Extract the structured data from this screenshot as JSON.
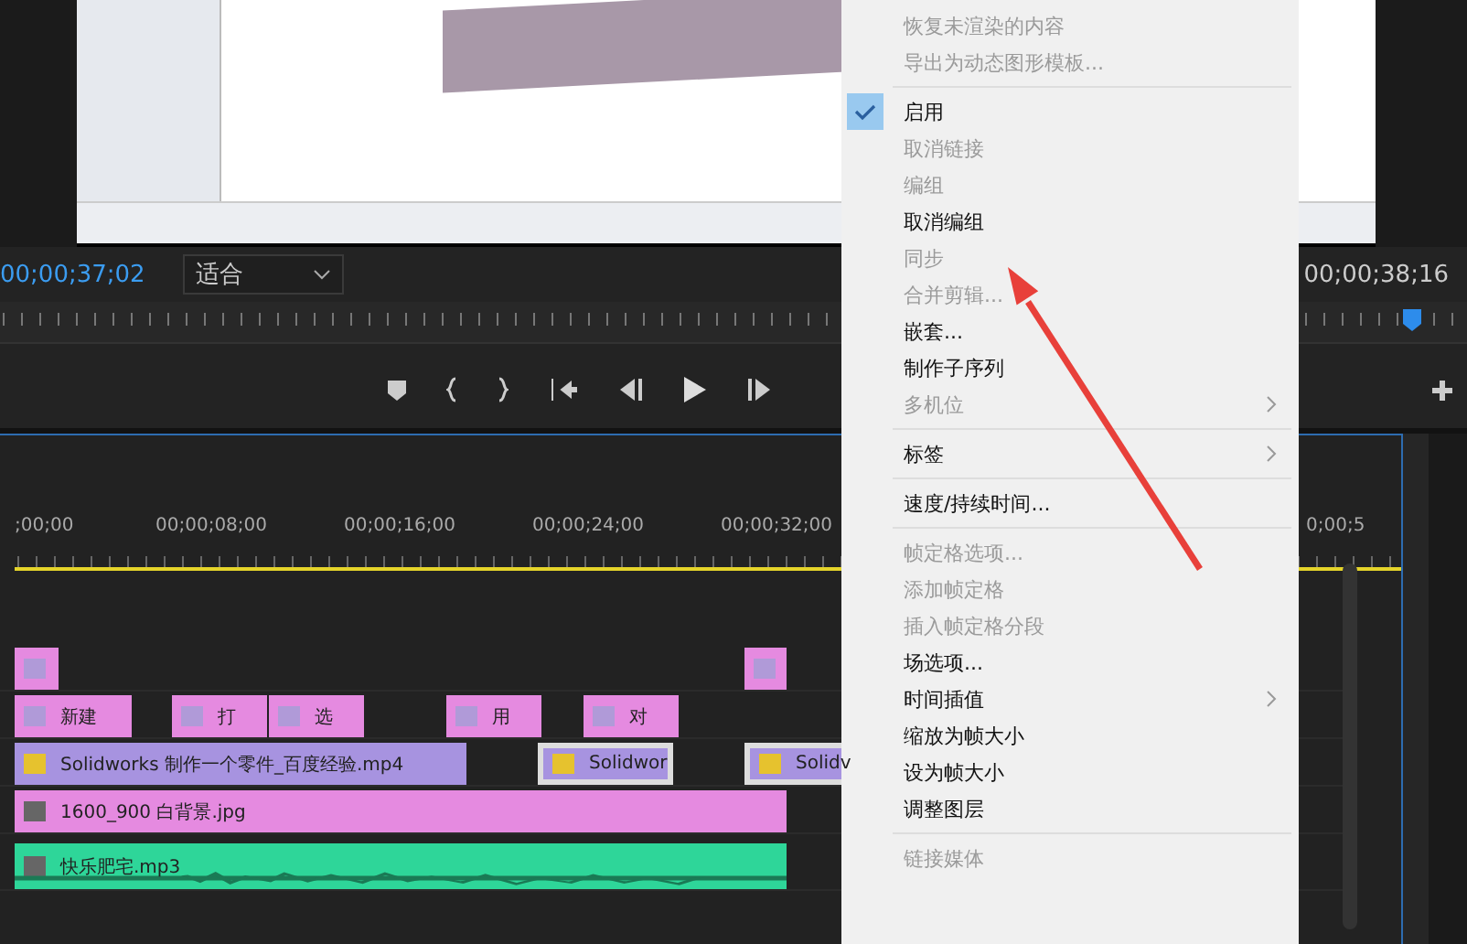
{
  "program_monitor": {
    "timecode": "00;00;37;02",
    "zoom_select": "适合",
    "end_timecode": "00;00;38;16"
  },
  "timeline": {
    "ruler_labels": [
      ";00;00",
      "00;00;08;00",
      "00;00;16;00",
      "00;00;24;00",
      "00;00;32;00"
    ],
    "ruler_label_right": "0;00;5",
    "tracks": [
      {
        "kind": "video",
        "clips": [
          {
            "color": "#e58ae0",
            "selected": false
          },
          {
            "color": "#e58ae0",
            "selected": false
          }
        ]
      },
      {
        "kind": "video",
        "clips": [
          {
            "label": "新建",
            "color": "#e58ae0",
            "selected": false
          },
          {
            "label": "打",
            "color": "#e58ae0",
            "selected": false
          },
          {
            "label": "选",
            "color": "#e58ae0",
            "selected": false
          },
          {
            "label": "用",
            "color": "#e58ae0",
            "selected": false
          },
          {
            "label": "对",
            "color": "#e58ae0",
            "selected": false
          }
        ]
      },
      {
        "kind": "video",
        "clips": [
          {
            "label": "Solidworks 制作一个零件_百度经验.mp4",
            "color": "#a793e0",
            "selected": false
          },
          {
            "label": "Solidwor",
            "color": "#a793e0",
            "selected": true
          },
          {
            "label": "Solidv",
            "color": "#a793e0",
            "selected": true
          }
        ]
      },
      {
        "kind": "video",
        "clips": [
          {
            "label": "1600_900 白背景.jpg",
            "color": "#e58ae0",
            "selected": false
          }
        ]
      },
      {
        "kind": "audio",
        "clips": [
          {
            "label": "快乐肥宅.mp3",
            "color": "#2ed699",
            "selected": false
          }
        ]
      }
    ]
  },
  "context_menu": [
    {
      "kind": "item",
      "label": "恢复未渲染的内容",
      "disabled": true,
      "checked": false,
      "submenu": false
    },
    {
      "kind": "item",
      "label": "导出为动态图形模板...",
      "disabled": true,
      "checked": false,
      "submenu": false
    },
    {
      "kind": "separator"
    },
    {
      "kind": "item",
      "label": "启用",
      "disabled": false,
      "checked": true,
      "submenu": false
    },
    {
      "kind": "item",
      "label": "取消链接",
      "disabled": true,
      "checked": false,
      "submenu": false
    },
    {
      "kind": "item",
      "label": "编组",
      "disabled": true,
      "checked": false,
      "submenu": false
    },
    {
      "kind": "item",
      "label": "取消编组",
      "disabled": false,
      "checked": false,
      "submenu": false
    },
    {
      "kind": "item",
      "label": "同步",
      "disabled": true,
      "checked": false,
      "submenu": false
    },
    {
      "kind": "item",
      "label": "合并剪辑...",
      "disabled": true,
      "checked": false,
      "submenu": false
    },
    {
      "kind": "item",
      "label": "嵌套...",
      "disabled": false,
      "checked": false,
      "submenu": false
    },
    {
      "kind": "item",
      "label": "制作子序列",
      "disabled": false,
      "checked": false,
      "submenu": false
    },
    {
      "kind": "item",
      "label": "多机位",
      "disabled": true,
      "checked": false,
      "submenu": true
    },
    {
      "kind": "separator"
    },
    {
      "kind": "item",
      "label": "标签",
      "disabled": false,
      "checked": false,
      "submenu": true
    },
    {
      "kind": "separator"
    },
    {
      "kind": "item",
      "label": "速度/持续时间...",
      "disabled": false,
      "checked": false,
      "submenu": false
    },
    {
      "kind": "separator"
    },
    {
      "kind": "item",
      "label": "帧定格选项...",
      "disabled": true,
      "checked": false,
      "submenu": false
    },
    {
      "kind": "item",
      "label": "添加帧定格",
      "disabled": true,
      "checked": false,
      "submenu": false
    },
    {
      "kind": "item",
      "label": "插入帧定格分段",
      "disabled": true,
      "checked": false,
      "submenu": false
    },
    {
      "kind": "item",
      "label": "场选项...",
      "disabled": false,
      "checked": false,
      "submenu": false
    },
    {
      "kind": "item",
      "label": "时间插值",
      "disabled": false,
      "checked": false,
      "submenu": true
    },
    {
      "kind": "item",
      "label": "缩放为帧大小",
      "disabled": false,
      "checked": false,
      "submenu": false
    },
    {
      "kind": "item",
      "label": "设为帧大小",
      "disabled": false,
      "checked": false,
      "submenu": false
    },
    {
      "kind": "item",
      "label": "调整图层",
      "disabled": false,
      "checked": false,
      "submenu": false
    },
    {
      "kind": "separator"
    },
    {
      "kind": "item",
      "label": "链接媒体",
      "disabled": true,
      "checked": false,
      "submenu": false
    }
  ]
}
